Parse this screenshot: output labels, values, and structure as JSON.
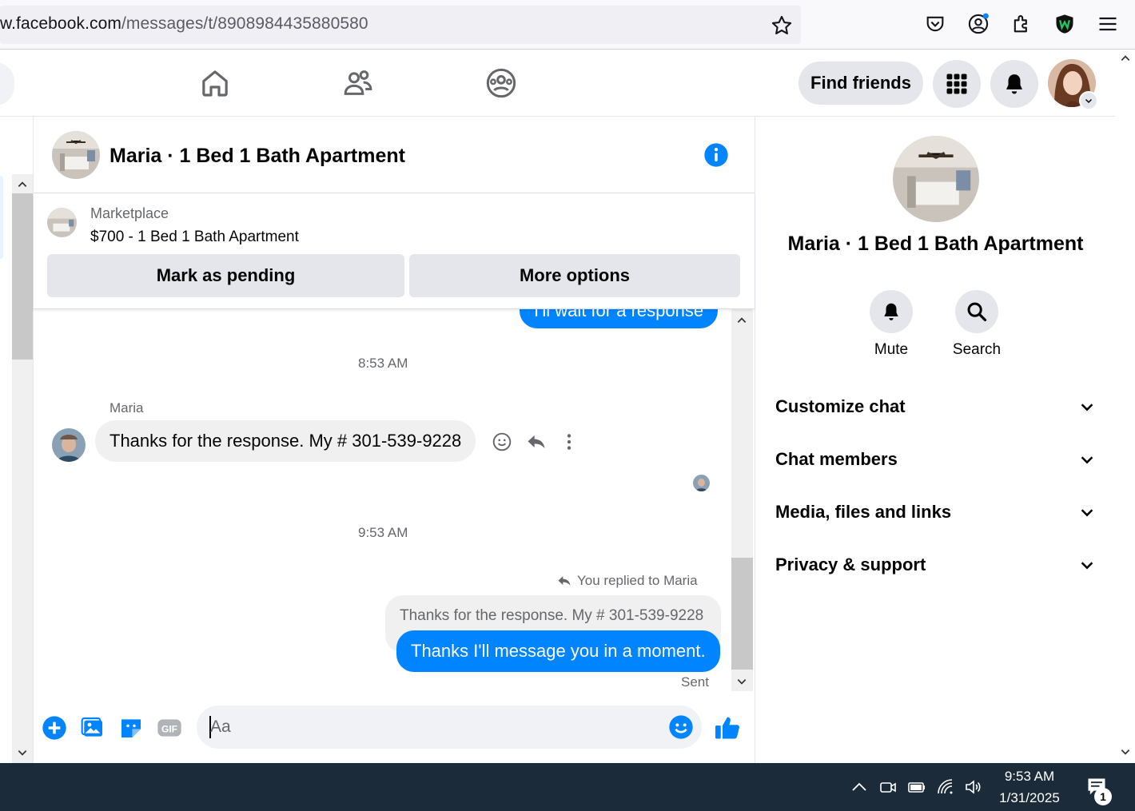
{
  "browser": {
    "url_host": "w.facebook.com",
    "url_path": "/messages/t/8908984435880580"
  },
  "header": {
    "find_friends_label": "Find friends"
  },
  "chat": {
    "title": "Maria · 1 Bed 1 Bath Apartment",
    "marketplace": {
      "label": "Marketplace",
      "item": "$700 - 1 Bed 1 Bath Apartment",
      "mark_pending_label": "Mark as pending",
      "more_options_label": "More options"
    },
    "messages": {
      "partial_outgoing": "I'll wait for a response",
      "timestamp_1": "8:53 AM",
      "sender_name": "Maria",
      "incoming_text": "Thanks for the response. My # 301-539-9228",
      "timestamp_2": "9:53 AM",
      "reply_context": "You replied to Maria",
      "quoted_text": "Thanks for the response. My # 301-539-9228",
      "outgoing_text": "Thanks I'll message you in a moment.",
      "status": "Sent"
    },
    "composer": {
      "placeholder": "Aa"
    }
  },
  "right_panel": {
    "title": "Maria · 1 Bed 1 Bath Apartment",
    "mute_label": "Mute",
    "search_label": "Search",
    "sections": [
      "Customize chat",
      "Chat members",
      "Media, files and links",
      "Privacy & support"
    ]
  },
  "taskbar": {
    "time": "9:53 AM",
    "date": "1/31/2025",
    "notification_count": "1"
  },
  "colors": {
    "accent": "#0084ff",
    "taskbar": "#1c2b3a"
  }
}
